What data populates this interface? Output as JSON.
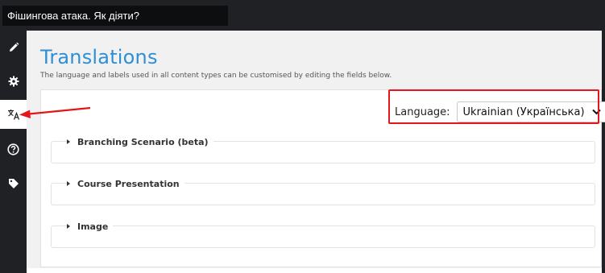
{
  "header": {
    "title_value": "Фішингова атака. Як діяти?"
  },
  "sidebar": {
    "items": [
      {
        "name": "edit",
        "icon": "pencil-icon"
      },
      {
        "name": "settings",
        "icon": "gear-icon"
      },
      {
        "name": "translations",
        "icon": "translate-icon",
        "active": true
      },
      {
        "name": "help",
        "icon": "question-circle-icon"
      },
      {
        "name": "tags",
        "icon": "tag-icon"
      }
    ]
  },
  "main": {
    "title": "Translations",
    "description": "The language and labels used in all content types can be customised by editing the fields below.",
    "language": {
      "label": "Language:",
      "selected": "Ukrainian (Українська)"
    },
    "groups": [
      {
        "label": "Branching Scenario (beta)"
      },
      {
        "label": "Course Presentation"
      },
      {
        "label": "Image"
      }
    ]
  },
  "colors": {
    "sidebar_bg": "#1f2124",
    "title_blue": "#2e8fd6",
    "highlight_red": "#e3161b"
  }
}
